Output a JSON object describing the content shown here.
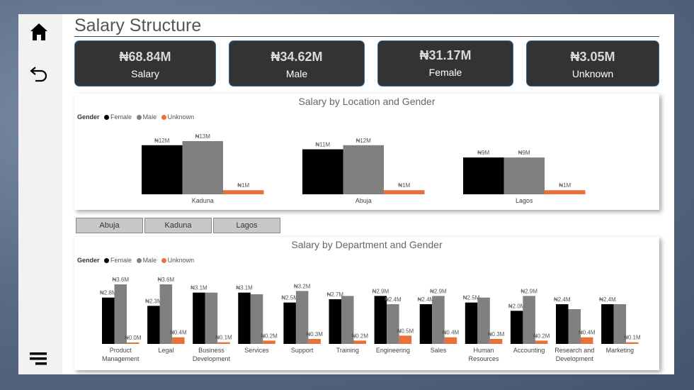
{
  "page_title": "Salary Structure",
  "kpis": [
    {
      "value": "₦68.84M",
      "label": "Salary"
    },
    {
      "value": "₦34.62M",
      "label": "Male"
    },
    {
      "value": "₦31.17M",
      "label": "Female"
    },
    {
      "value": "₦3.05M",
      "label": "Unknown"
    }
  ],
  "slicer_buttons": [
    "Abuja",
    "Kaduna",
    "Lagos"
  ],
  "icons": {
    "home": "home-icon",
    "back": "back-arrow-icon",
    "menu": "menu-icon"
  },
  "colors": {
    "female": "#000000",
    "male": "#808080",
    "unknown": "#e8703a",
    "kpi_bg": "#333333"
  },
  "chart_data": [
    {
      "type": "bar",
      "title": "Salary by Location and Gender",
      "legend_title": "Gender",
      "legend_position": "top-left",
      "categories": [
        "Kaduna",
        "Abuja",
        "Lagos"
      ],
      "series": [
        {
          "name": "Female",
          "values": [
            12,
            11,
            9
          ],
          "labels": [
            "₦12M",
            "₦11M",
            "₦9M"
          ]
        },
        {
          "name": "Male",
          "values": [
            13,
            12,
            9
          ],
          "labels": [
            "₦13M",
            "₦12M",
            "₦9M"
          ]
        },
        {
          "name": "Unknown",
          "values": [
            1,
            1,
            1
          ],
          "labels": [
            "₦1M",
            "₦1M",
            "₦1M"
          ]
        }
      ]
    },
    {
      "type": "bar",
      "title": "Salary by Department and Gender",
      "legend_title": "Gender",
      "legend_position": "top-left",
      "categories": [
        "Product Management",
        "Legal",
        "Business Development",
        "Services",
        "Support",
        "Training",
        "Engineering",
        "Sales",
        "Human Resources",
        "Accounting",
        "Research and Development",
        "Marketing"
      ],
      "series": [
        {
          "name": "Female",
          "values": [
            2.8,
            2.3,
            3.1,
            3.1,
            2.5,
            2.7,
            2.9,
            2.4,
            2.5,
            2.0,
            2.4,
            2.4
          ],
          "labels": [
            "₦2.8M",
            "₦2.3M",
            "₦3.1M",
            "₦3.1M",
            "₦2.5M",
            "₦2.7M",
            "₦2.9M",
            "₦2.4M",
            "₦2.5M",
            "₦2.0M",
            "₦2.4M",
            "₦2.4M"
          ]
        },
        {
          "name": "Male",
          "values": [
            3.6,
            3.6,
            3.1,
            3.0,
            3.2,
            2.9,
            2.4,
            2.9,
            2.8,
            2.9,
            2.1,
            2.4
          ],
          "labels": [
            "₦3.6M",
            "₦3.6M",
            "",
            "",
            "₦3.2M",
            "",
            "₦2.4M",
            "₦2.9M",
            "",
            "₦2.9M",
            "",
            ""
          ]
        },
        {
          "name": "Unknown",
          "values": [
            0.0,
            0.4,
            0.1,
            0.2,
            0.3,
            0.2,
            0.5,
            0.4,
            0.3,
            0.2,
            0.4,
            0.1
          ],
          "labels": [
            "₦0.0M",
            "₦0.4M",
            "₦0.1M",
            "₦0.2M",
            "₦0.3M",
            "₦0.2M",
            "₦0.5M",
            "₦0.4M",
            "₦0.3M",
            "₦0.2M",
            "₦0.4M",
            "₦0.1M"
          ]
        }
      ]
    }
  ]
}
